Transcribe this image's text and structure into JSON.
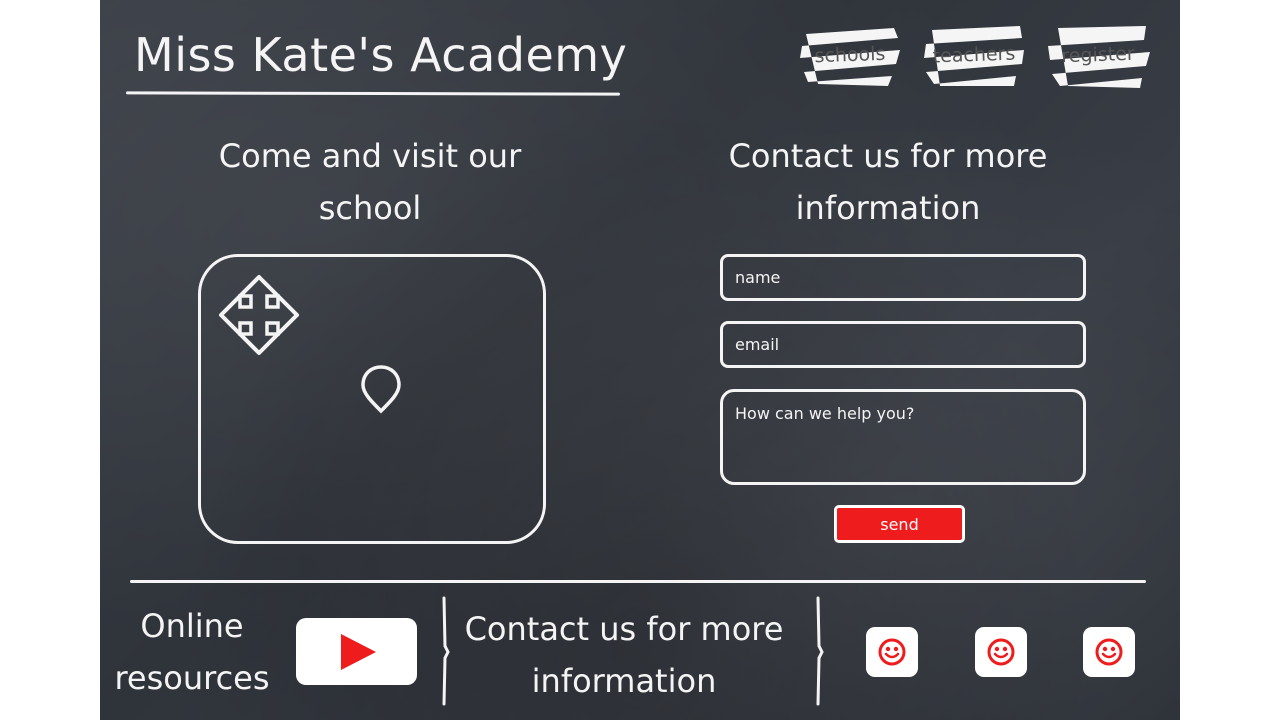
{
  "header": {
    "title": "Miss Kate's Academy",
    "nav": [
      {
        "label": "schools"
      },
      {
        "label": "teachers"
      },
      {
        "label": "register"
      }
    ]
  },
  "visit": {
    "heading_line1": "Come and visit our",
    "heading_line2": "school",
    "map_icons": [
      "move-arrows-icon",
      "map-pin-icon"
    ]
  },
  "contact": {
    "heading_line1": "Contact us for more",
    "heading_line2": "information",
    "name_placeholder": "name",
    "email_placeholder": "email",
    "message_placeholder": "How can we help you?",
    "send_label": "send"
  },
  "footer": {
    "resources_line1": "Online",
    "resources_line2": "resources",
    "video_icon": "play-icon",
    "contact_line1": "Contact us for more",
    "contact_line2": "information",
    "social_icons": [
      "smiley-icon",
      "smiley-icon",
      "smiley-icon"
    ]
  },
  "colors": {
    "chalkboard": "#34383f",
    "chalk": "#f4f4f4",
    "accent_red": "#ee1c1c",
    "nav_text": "#555555"
  }
}
